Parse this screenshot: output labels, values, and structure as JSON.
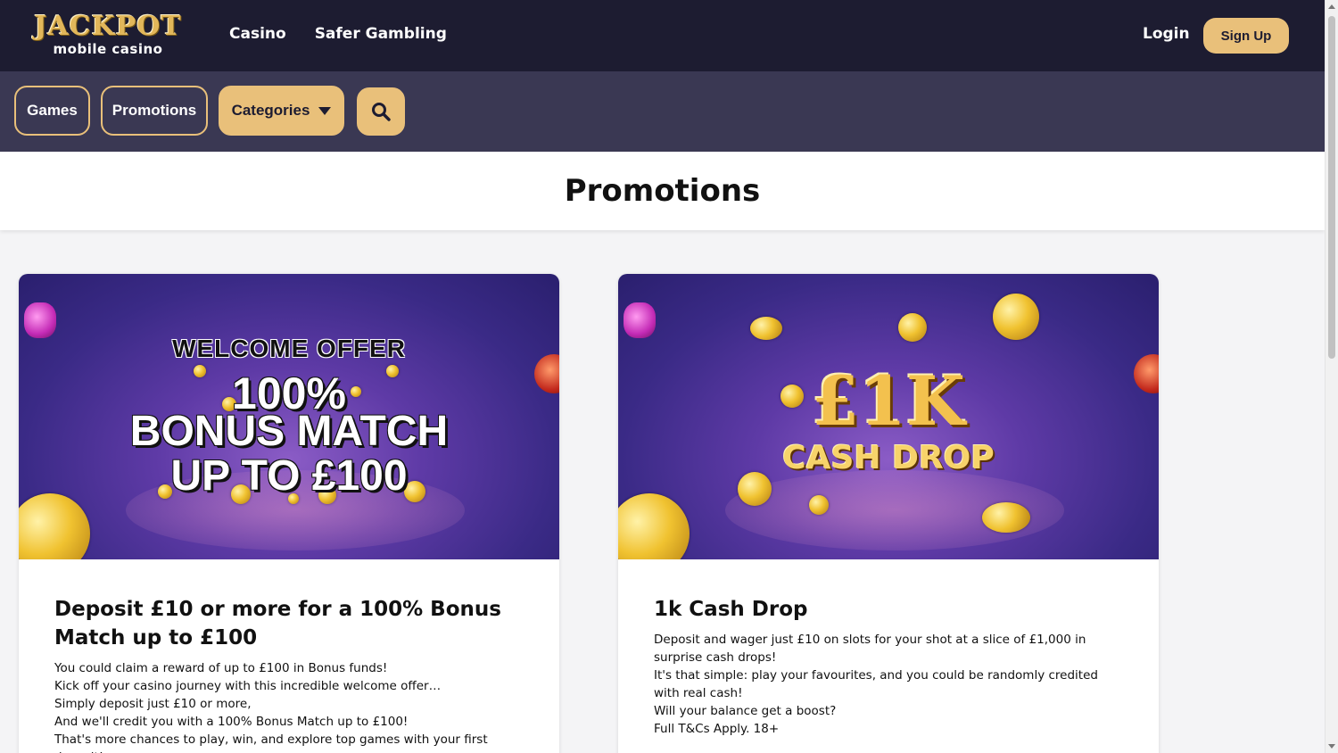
{
  "header": {
    "logo_top": "JACKPOT",
    "logo_bottom": "mobile casino",
    "nav": [
      "Casino",
      "Safer Gambling"
    ],
    "login_label": "Login",
    "signup_label": "Sign Up"
  },
  "subnav": {
    "games_label": "Games",
    "promotions_label": "Promotions",
    "categories_label": "Categories",
    "search_icon": "search-icon"
  },
  "page": {
    "title": "Promotions"
  },
  "promos": [
    {
      "banner": {
        "line1": "WELCOME OFFER",
        "line2": "100%",
        "line3": "BONUS MATCH",
        "line4": "UP TO £100"
      },
      "title": "Deposit £10 or more for a 100% Bonus Match up to £100",
      "lines": [
        "You could claim a reward of up to £100 in Bonus funds!",
        "Kick off your casino journey with this incredible welcome offer…",
        "Simply deposit just £10 or more,",
        "And we'll credit you with a 100% Bonus Match up to £100!",
        "That's more chances to play, win, and explore top games with your first deposit!"
      ]
    },
    {
      "banner": {
        "line1": "£1K",
        "line2": "CASH DROP"
      },
      "title": "1k Cash Drop",
      "lines": [
        "Deposit and wager just £10 on slots for your shot at a slice of £1,000 in surprise cash drops!",
        "It's that simple: play your favourites, and you could be randomly credited with real cash!",
        "Will your balance get a boost?",
        "Full T&Cs Apply. 18+"
      ]
    }
  ],
  "colors": {
    "header_bg": "#1d1c31",
    "subnav_bg": "#3a3853",
    "accent_gold": "#e9c07a"
  }
}
